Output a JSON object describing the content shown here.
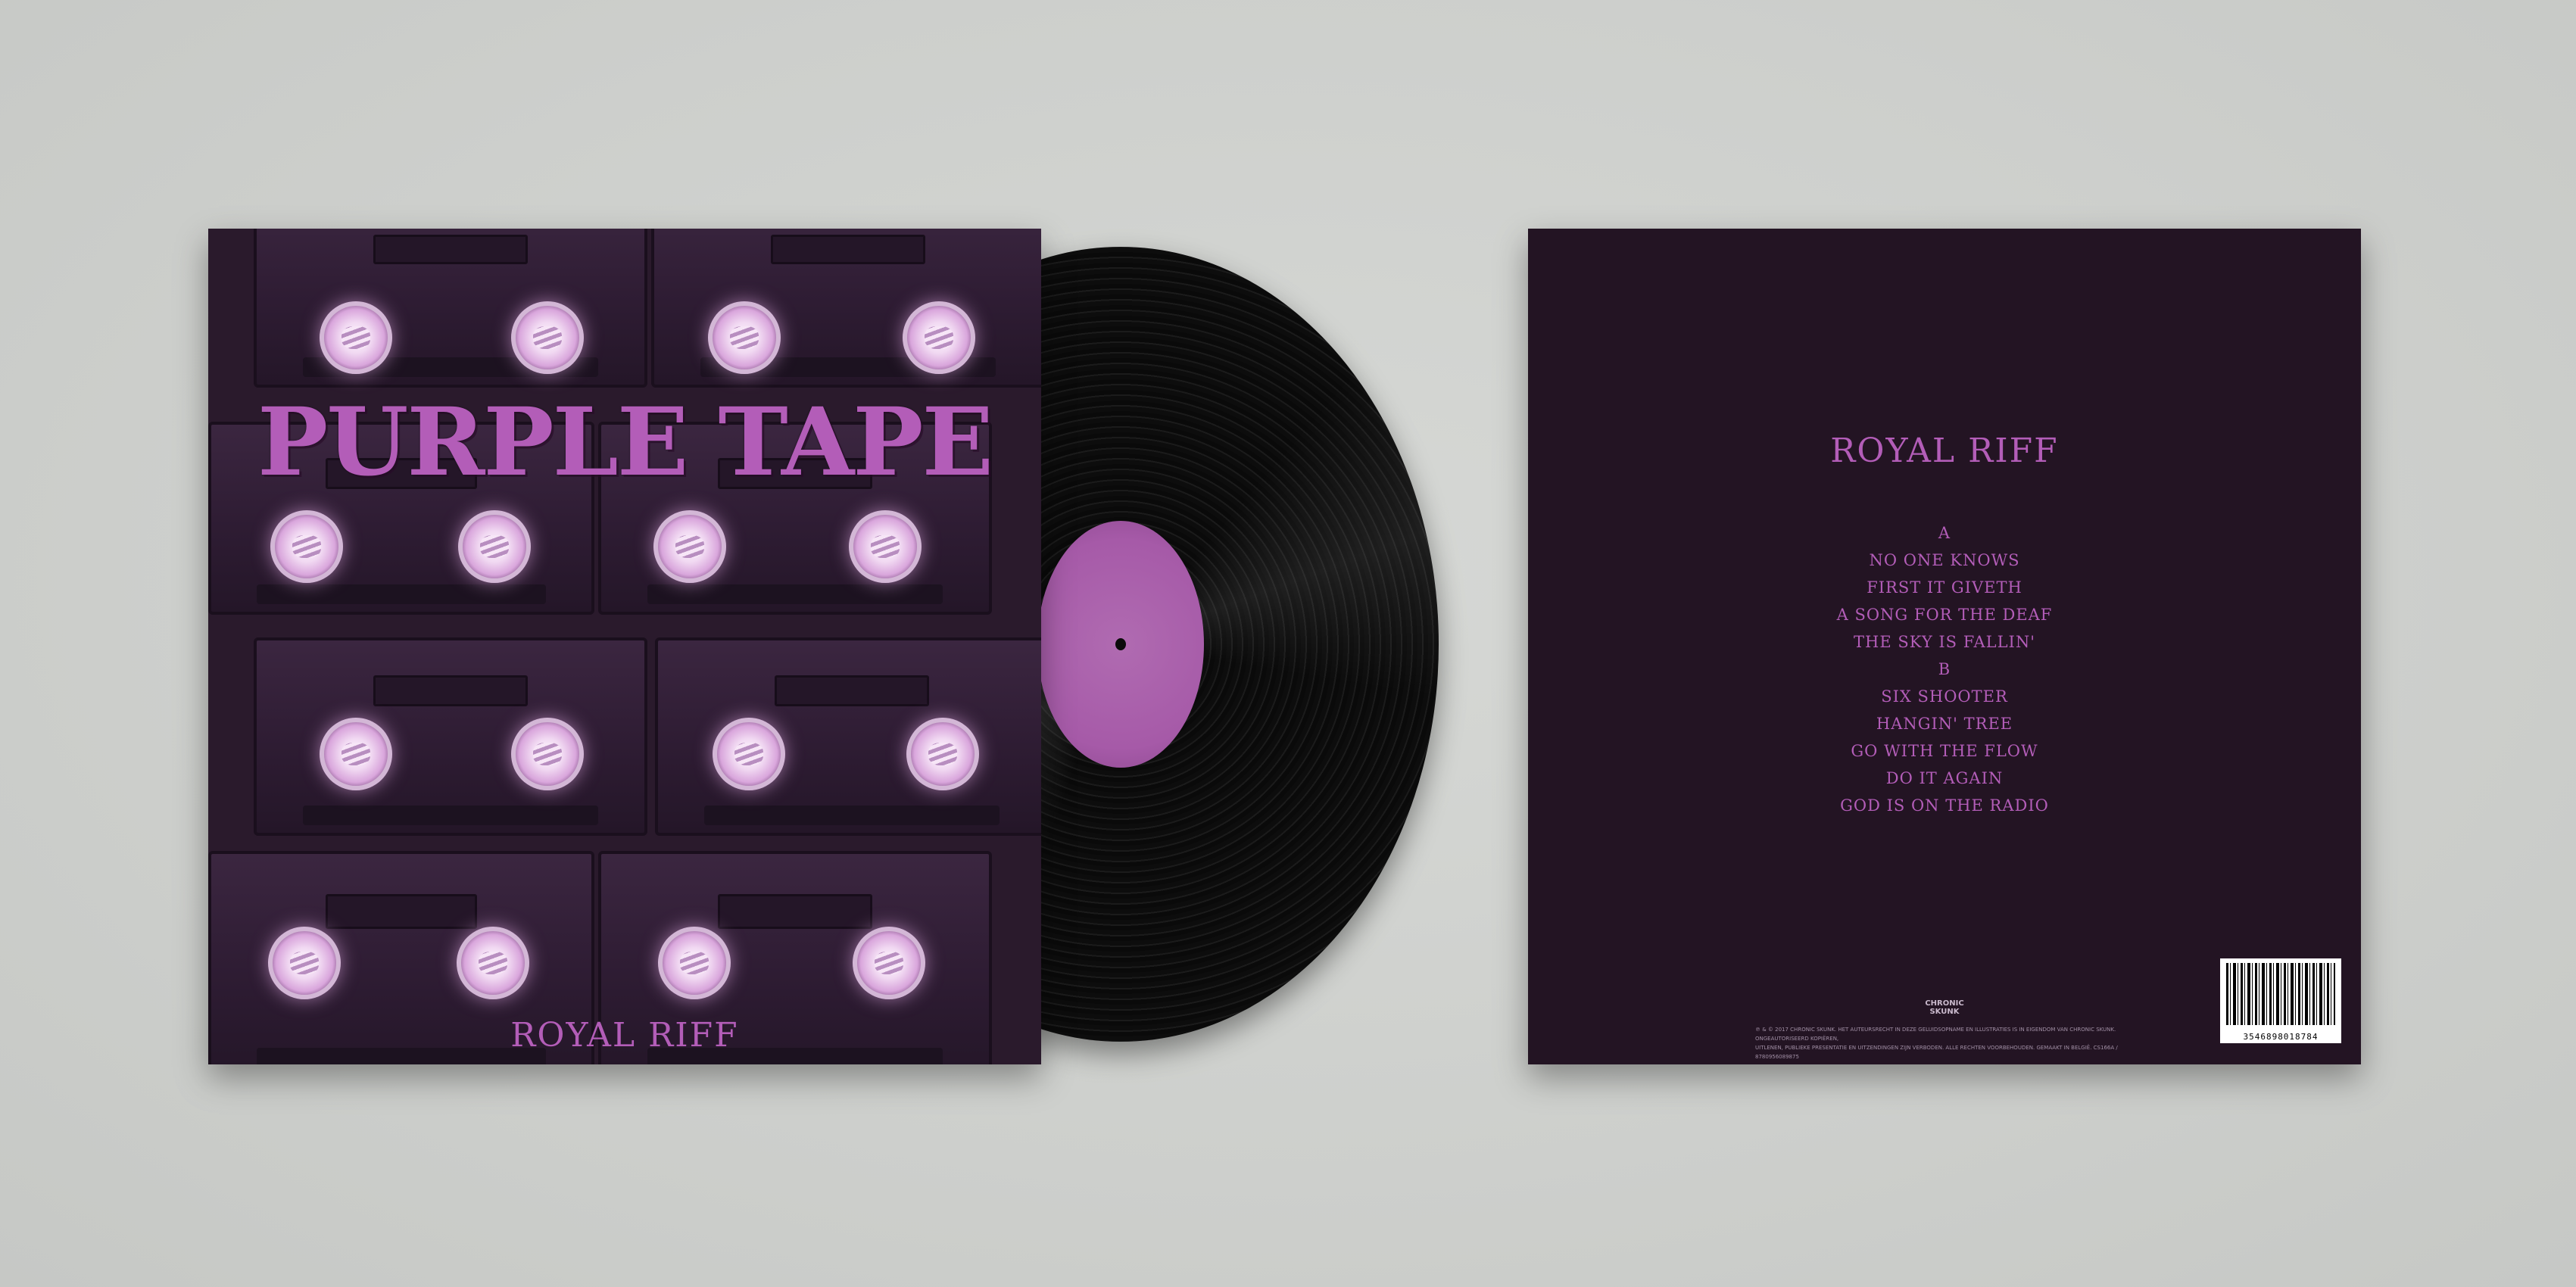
{
  "front": {
    "title": "PURPLE TAPE",
    "artist": "ROYAL RIFF"
  },
  "back": {
    "artist": "ROYAL RIFF",
    "tracks": [
      "A",
      "NO ONE KNOWS",
      "FIRST IT GIVETH",
      "A SONG FOR THE DEAF",
      "THE SKY IS FALLIN'",
      "B",
      "SIX SHOOTER",
      "HANGIN' TREE",
      "GO WITH THE FLOW",
      "DO IT AGAIN",
      "GOD IS ON THE RADIO"
    ],
    "logo": "CHRONIC SKUNK",
    "legal_1": "℗ & © 2017 CHRONIC SKUNK. HET AUTEURSRECHT IN DEZE GELUIDSOPNAME EN ILLUSTRATIES IS IN EIGENDOM VAN CHRONIC SKUNK. ONGEAUTORISEERD KOPIËREN,",
    "legal_2": "UITLENEN, PUBLIEKE PRESENTATIE EN UITZENDINGEN ZIJN VERBODEN. ALLE RECHTEN VOORBEHOUDEN. GEMAAKT IN BELGIË. CS166A / 8780956089875",
    "barcode": "3546898018784"
  },
  "colors": {
    "accent": "#b35db8",
    "cover_bg": "#231423",
    "background": "#cfd1ce",
    "record_label": "#a65aa8"
  }
}
